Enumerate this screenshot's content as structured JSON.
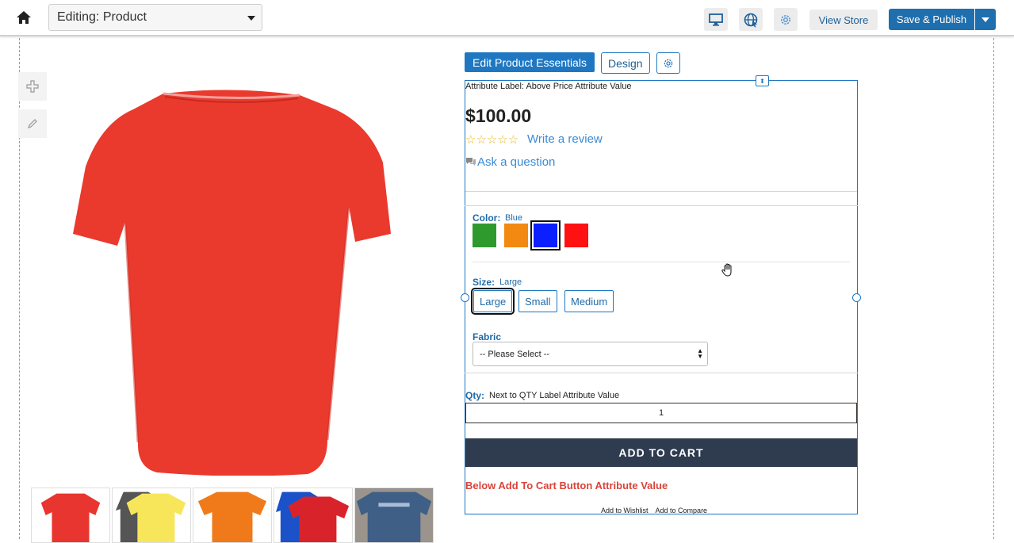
{
  "topbar": {
    "editing_label": "Editing: Product",
    "icons": [
      "home-icon",
      "desktop-icon",
      "globe-icon",
      "gear-icon"
    ],
    "view_store": "View Store",
    "save_publish": "Save & Publish"
  },
  "editor": {
    "tools": [
      "move-icon",
      "pencil-icon"
    ],
    "edit_essentials": "Edit Product Essentials",
    "design": "Design"
  },
  "product": {
    "main_image_color": "#e8352f",
    "thumbnails": [
      {
        "colors": [
          "#e8352f"
        ]
      },
      {
        "colors": [
          "#555555",
          "#f7e65a"
        ]
      },
      {
        "colors": [
          "#f07a1a"
        ]
      },
      {
        "colors": [
          "#1b52c9",
          "#d9232b"
        ]
      },
      {
        "colors": [
          "#3f5f86"
        ]
      }
    ],
    "attribute_label": "Attribute Label:",
    "attribute_value": "Above Price Attribute Value",
    "price": "$100.00",
    "stars": "☆☆☆☆☆",
    "write_review": "Write a review",
    "ask_question": "Ask a question",
    "color": {
      "label": "Color:",
      "value": "Blue",
      "swatches": [
        {
          "name": "Green",
          "hex": "#2e9a2e",
          "selected": false
        },
        {
          "name": "Orange",
          "hex": "#f28a12",
          "selected": false
        },
        {
          "name": "Blue",
          "hex": "#0b1fff",
          "selected": true
        },
        {
          "name": "Red",
          "hex": "#ff1111",
          "selected": false
        }
      ]
    },
    "size": {
      "label": "Size:",
      "value": "Large",
      "options": [
        {
          "label": "Large",
          "selected": true
        },
        {
          "label": "Small",
          "selected": false
        },
        {
          "label": "Medium",
          "selected": false
        }
      ]
    },
    "fabric": {
      "label": "Fabric",
      "selected": "-- Please Select --"
    },
    "qty": {
      "label": "Qty:",
      "attribute_value": "Next to QTY Label Attribute Value",
      "value": "1"
    },
    "add_to_cart": "ADD TO CART",
    "below_cart": "Below Add To Cart Button Attribute Value",
    "add_to_wishlist": "Add to Wishlist",
    "add_to_compare": "Add to Compare"
  }
}
